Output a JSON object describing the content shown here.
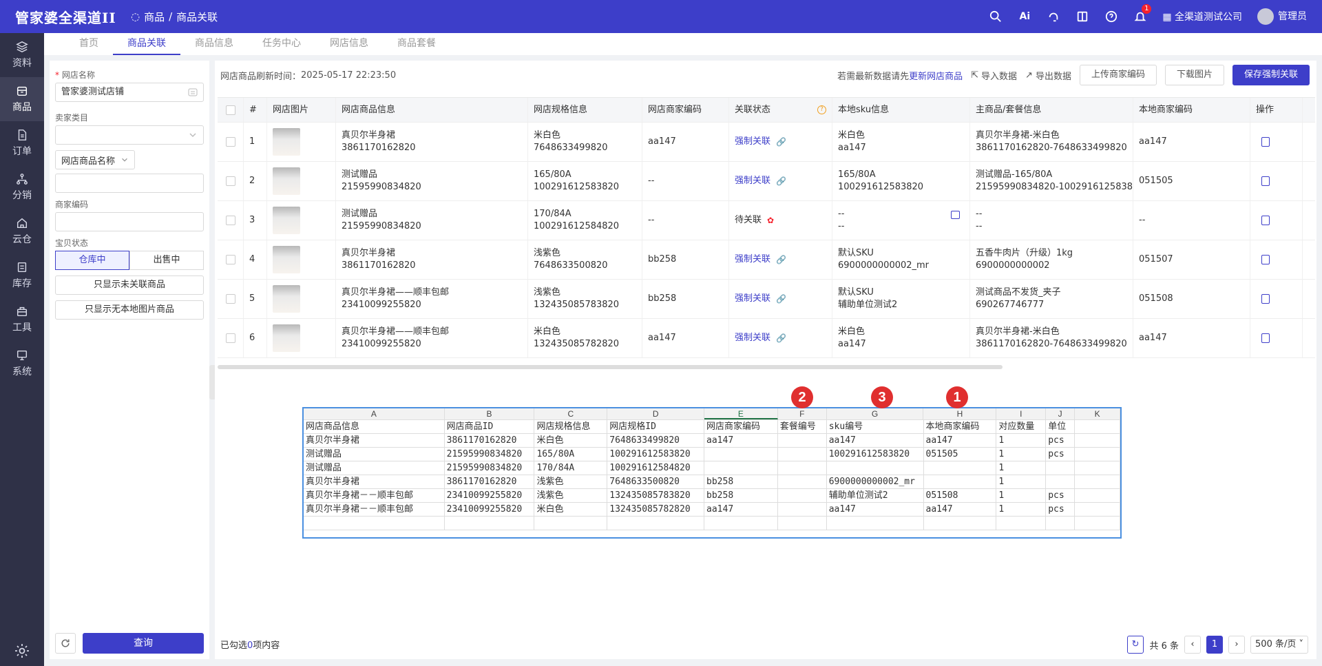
{
  "app": {
    "logo": "管家婆全渠道II",
    "breadcrumb_section": "商品",
    "breadcrumb_sep": "/",
    "breadcrumb_page": "商品关联",
    "company": "全渠道测试公司",
    "user": "管理员",
    "notify_count": "1"
  },
  "sidebar": [
    {
      "label": "资料",
      "icon": "layers-icon"
    },
    {
      "label": "商品",
      "icon": "box-icon"
    },
    {
      "label": "订单",
      "icon": "document-icon"
    },
    {
      "label": "分销",
      "icon": "network-icon"
    },
    {
      "label": "云仓",
      "icon": "cloud-warehouse-icon"
    },
    {
      "label": "库存",
      "icon": "inventory-icon"
    },
    {
      "label": "工具",
      "icon": "toolbox-icon"
    },
    {
      "label": "系统",
      "icon": "monitor-icon"
    }
  ],
  "tabs": [
    "首页",
    "商品关联",
    "商品信息",
    "任务中心",
    "网店信息",
    "商品套餐"
  ],
  "filter": {
    "shop_label": "网店名称",
    "shop_value": "管家婆测试店铺",
    "seller_cat_label": "卖家类目",
    "search_field": "网店商品名称",
    "merchant_code_label": "商家编码",
    "item_status_label": "宝贝状态",
    "status_in_stock": "仓库中",
    "status_on_sale": "出售中",
    "only_unlinked": "只显示未关联商品",
    "only_no_image": "只显示无本地图片商品",
    "query": "查询"
  },
  "header": {
    "refresh_label": "网店商品刷新时间：",
    "refresh_time": "2025-05-17 22:23:50",
    "tip": "若需最新数据请先",
    "tip_link": "更新网店商品",
    "import": "导入数据",
    "export": "导出数据",
    "upload": "上传商家编码",
    "download": "下载图片",
    "save": "保存强制关联"
  },
  "columns": [
    "#",
    "网店图片",
    "网店商品信息",
    "网店规格信息",
    "网店商家编码",
    "关联状态",
    "本地sku信息",
    "主商品/套餐信息",
    "本地商家编码",
    "操作"
  ],
  "rows": [
    {
      "no": "1",
      "name": "真贝尔半身裙",
      "id": "3861170162820",
      "spec": "米白色",
      "spec_id": "7648633499820",
      "code": "aa147",
      "status": "强制关联",
      "sku1": "米白色",
      "sku2": "aa147",
      "main1": "真贝尔半身裙-米白色",
      "main2": "3861170162820-7648633499820",
      "local": "aa147"
    },
    {
      "no": "2",
      "name": "测试赠品",
      "id": "21595990834820",
      "spec": "165/80A",
      "spec_id": "100291612583820",
      "code": "--",
      "status": "强制关联",
      "sku1": "165/80A",
      "sku2": "100291612583820",
      "main1": "测试赠品-165/80A",
      "main2": "21595990834820-1002916125838...",
      "local": "051505"
    },
    {
      "no": "3",
      "name": "测试赠品",
      "id": "21595990834820",
      "spec": "170/84A",
      "spec_id": "100291612584820",
      "code": "--",
      "status": "待关联",
      "sku1": "--",
      "sku2": "--",
      "main1": "--",
      "main2": "--",
      "local": "--"
    },
    {
      "no": "4",
      "name": "真贝尔半身裙",
      "id": "3861170162820",
      "spec": "浅紫色",
      "spec_id": "7648633500820",
      "code": "bb258",
      "status": "强制关联",
      "sku1": "默认SKU",
      "sku2": "6900000000002_mr",
      "main1": "五香牛肉片（升级）1kg",
      "main2": "6900000000002",
      "local": "051507"
    },
    {
      "no": "5",
      "name": "真贝尔半身裙——顺丰包邮",
      "id": "23410099255820",
      "spec": "浅紫色",
      "spec_id": "132435085783820",
      "code": "bb258",
      "status": "强制关联",
      "sku1": "默认SKU",
      "sku2": "辅助单位测试2",
      "main1": "测试商品不发货_夹子",
      "main2": "690267746777",
      "local": "051508"
    },
    {
      "no": "6",
      "name": "真贝尔半身裙——顺丰包邮",
      "id": "23410099255820",
      "spec": "米白色",
      "spec_id": "132435085782820",
      "code": "aa147",
      "status": "强制关联",
      "sku1": "米白色",
      "sku2": "aa147",
      "main1": "真贝尔半身裙-米白色",
      "main2": "3861170162820-7648633499820",
      "local": "aa147"
    }
  ],
  "footer": {
    "selected_pre": "已勾选",
    "selected_count": "0",
    "selected_post": "项内容",
    "total": "共 6 条",
    "page": "1",
    "page_size": "500 条/页"
  },
  "sheet": {
    "col_letters": [
      "A",
      "B",
      "C",
      "D",
      "E",
      "F",
      "G",
      "H",
      "I",
      "J",
      "K"
    ],
    "markers": [
      "2",
      "3",
      "1"
    ],
    "rows": [
      [
        "网店商品信息",
        "网店商品ID",
        "网店规格信息",
        "网店规格ID",
        "网店商家编码",
        "套餐编号",
        "sku编号",
        "本地商家编码",
        "对应数量",
        "单位",
        ""
      ],
      [
        "真贝尔半身裙",
        "3861170162820",
        "米白色",
        "7648633499820",
        "aa147",
        "",
        "aa147",
        "aa147",
        "1",
        "pcs",
        ""
      ],
      [
        "测试赠品",
        "21595990834820",
        "165/80A",
        "100291612583820",
        "",
        "",
        "100291612583820",
        "051505",
        "1",
        "pcs",
        ""
      ],
      [
        "测试赠品",
        "21595990834820",
        "170/84A",
        "100291612584820",
        "",
        "",
        "",
        "",
        "1",
        "",
        ""
      ],
      [
        "真贝尔半身裙",
        "3861170162820",
        "浅紫色",
        "7648633500820",
        "bb258",
        "",
        "6900000000002_mr",
        "",
        "1",
        "",
        ""
      ],
      [
        "真贝尔半身裙－－顺丰包邮",
        "23410099255820",
        "浅紫色",
        "132435085783820",
        "bb258",
        "",
        "辅助单位测试2",
        "051508",
        "1",
        "pcs",
        ""
      ],
      [
        "真贝尔半身裙－－顺丰包邮",
        "23410099255820",
        "米白色",
        "132435085782820",
        "aa147",
        "",
        "aa147",
        "aa147",
        "1",
        "pcs",
        ""
      ],
      [
        "",
        "",
        "",
        "",
        "",
        "",
        "",
        "",
        "",
        "",
        ""
      ]
    ]
  },
  "colors": {
    "primary": "#3d3ec9",
    "sidebar": "#2f3147",
    "marker": "#e02f2f"
  }
}
